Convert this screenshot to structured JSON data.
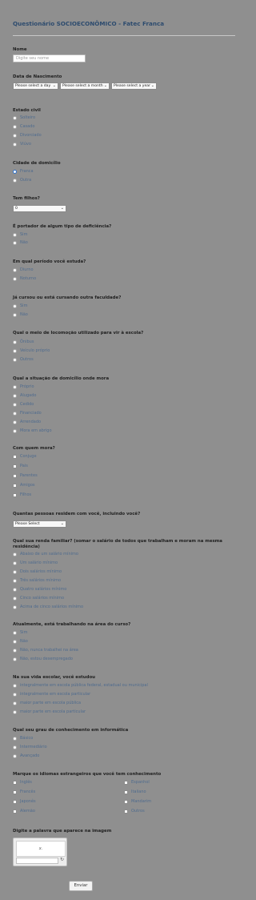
{
  "title": "Questionário SOCIOECONÔMICO - Fatec Franca",
  "nome": {
    "label": "Nome",
    "placeholder": "Digite seu nome"
  },
  "nascimento": {
    "label": "Data de Nascimento",
    "day": "Please select a day",
    "month": "Please select a month",
    "year": "Please select a year"
  },
  "estado_civil": {
    "label": "Estado civil",
    "options": [
      "Solteiro",
      "Casado",
      "Divorciado",
      "Viúvo"
    ]
  },
  "cidade": {
    "label": "Cidade de domicílio",
    "options": [
      "Franca",
      "Outra"
    ],
    "selected": 0
  },
  "filhos": {
    "label": "Tem filhos?",
    "value": "0"
  },
  "deficiencia": {
    "label": "É portador de algum tipo de deficiência?",
    "options": [
      "Sim",
      "Não"
    ]
  },
  "periodo": {
    "label": "Em qual período você estuda?",
    "options": [
      "Diurno",
      "Noturno"
    ]
  },
  "outra_faculdade": {
    "label": "Já cursou ou está cursando outra faculdade?",
    "options": [
      "Sim",
      "Não"
    ]
  },
  "locomocao": {
    "label": "Qual o meio de locomoção utilizado para vir à escola?",
    "options": [
      "Ônibus",
      "Veículo próprio",
      "Outros"
    ]
  },
  "situacao_domicilio": {
    "label": "Qual a situação de domicílio onde mora",
    "options": [
      "Próprio",
      "Alugado",
      "Cedido",
      "Financiado",
      "Arrendado",
      "Mora em abrigo"
    ]
  },
  "com_quem": {
    "label": "Com quem mora?",
    "options": [
      "Conjuge",
      "Pais",
      "Parentes",
      "Amigos",
      "Filhos"
    ]
  },
  "pessoas": {
    "label": "Quantas pessoas residem com você, incluindo você?",
    "value": "Please Select"
  },
  "renda": {
    "label_line1": "Qual sua renda familiar? (somar o salário de todos que trabalham e moram na mesma",
    "label_line2": "residência)",
    "options": [
      "Abaixo de um salário mínimo",
      "Um salário mínimo",
      "Dois salários mínimo",
      "Três salários mínimo",
      "Quatro salários mínimo",
      "Cinco salários mínimo",
      "Acima de cinco salários mínimo"
    ]
  },
  "trabalhando": {
    "label": "Atualmente, está trabalhando na área do curso?",
    "options": [
      "Sim",
      "Não",
      "Não, nunca trabalhei na área",
      "Não, estou desempregado"
    ]
  },
  "vida_escolar": {
    "label": "Na sua vida escolar, você estudou",
    "options": [
      "integralmente em escola pública federal, estadual ou municipal",
      "integralmente em escola particular",
      "maior parte em escola pública",
      "maior parte em escola particular"
    ]
  },
  "informatica": {
    "label": "Qual seu grau de conhecimento em informática",
    "options": [
      "Básico",
      "Intermediário",
      "Avançado"
    ]
  },
  "idiomas": {
    "label": "Marque os idiomas estrangeiros que você tem conhecimento",
    "left": [
      "Inglês",
      "Francês",
      "Japonês",
      "Alemão"
    ],
    "right": [
      "Espanhol",
      "Italiano",
      "Mandarim",
      "Outros"
    ]
  },
  "captcha": {
    "label": "Digite a palavra que aparece na imagem",
    "image_text": "x.",
    "refresh_icon": "refresh-icon"
  },
  "submit": {
    "label": "Enviar"
  },
  "colors": {
    "background": "#8f8f8f",
    "title": "#2d4b6e",
    "option_text": "#4f6b8e",
    "radio_selected": "#2f74d0"
  }
}
